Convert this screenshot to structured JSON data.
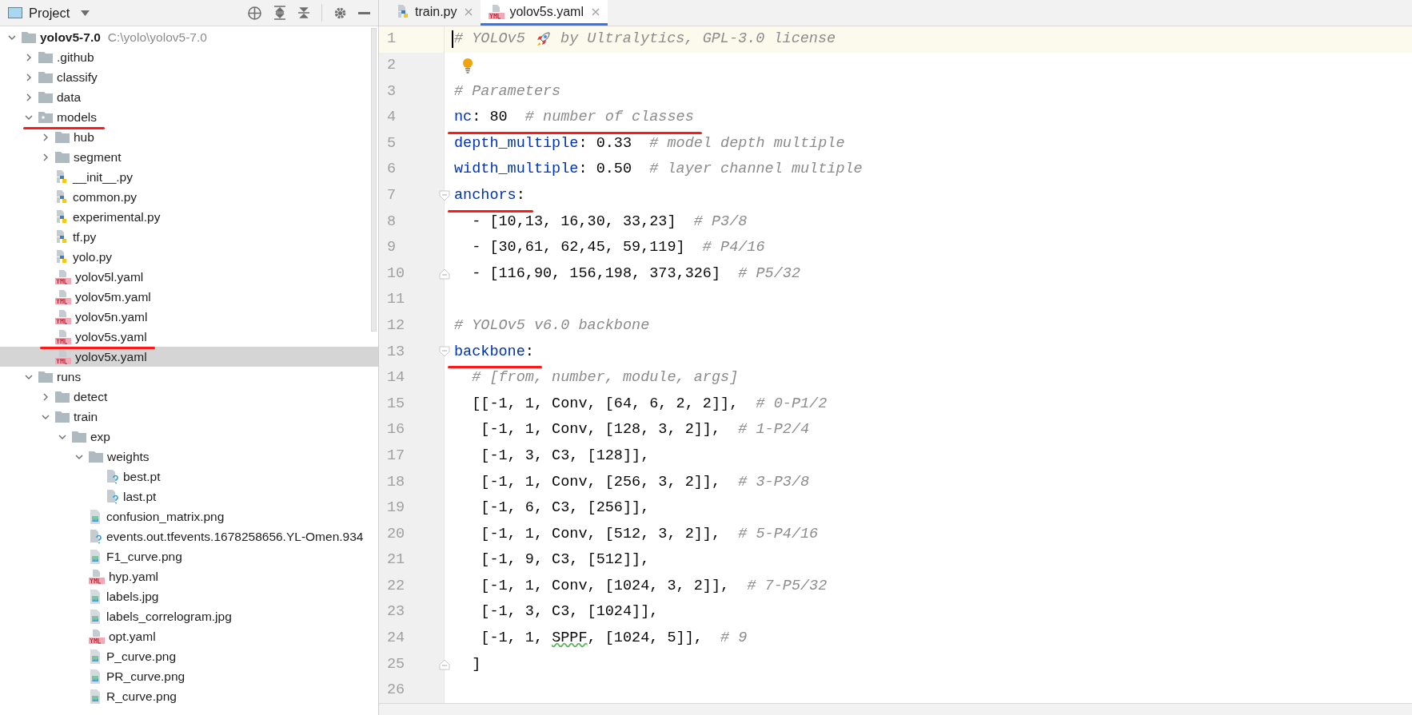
{
  "project_panel": {
    "title": "Project",
    "tree": [
      {
        "name": "yolov5-7.0",
        "path": "C:\\yolo\\yolov5-7.0",
        "kind": "folder",
        "expanded": true,
        "selected": false,
        "marked": false,
        "children": [
          {
            "name": ".github",
            "kind": "folder",
            "expanded": false,
            "selected": false,
            "marked": false
          },
          {
            "name": "classify",
            "kind": "folder",
            "expanded": false,
            "selected": false,
            "marked": false
          },
          {
            "name": "data",
            "kind": "folder",
            "expanded": false,
            "selected": false,
            "marked": false
          },
          {
            "name": "models",
            "kind": "package",
            "expanded": true,
            "selected": false,
            "marked": true,
            "children": [
              {
                "name": "hub",
                "kind": "folder",
                "expanded": false,
                "selected": false,
                "marked": false
              },
              {
                "name": "segment",
                "kind": "folder",
                "expanded": false,
                "selected": false,
                "marked": false
              },
              {
                "name": "__init__.py",
                "kind": "python",
                "selected": false,
                "marked": false
              },
              {
                "name": "common.py",
                "kind": "python",
                "selected": false,
                "marked": false
              },
              {
                "name": "experimental.py",
                "kind": "python",
                "selected": false,
                "marked": false
              },
              {
                "name": "tf.py",
                "kind": "python",
                "selected": false,
                "marked": false
              },
              {
                "name": "yolo.py",
                "kind": "python",
                "selected": false,
                "marked": false
              },
              {
                "name": "yolov5l.yaml",
                "kind": "yaml",
                "selected": false,
                "marked": false
              },
              {
                "name": "yolov5m.yaml",
                "kind": "yaml",
                "selected": false,
                "marked": false
              },
              {
                "name": "yolov5n.yaml",
                "kind": "yaml",
                "selected": false,
                "marked": false
              },
              {
                "name": "yolov5s.yaml",
                "kind": "yaml",
                "selected": false,
                "marked": true
              },
              {
                "name": "yolov5x.yaml",
                "kind": "yaml",
                "selected": true,
                "marked": false
              }
            ]
          },
          {
            "name": "runs",
            "kind": "folder",
            "expanded": true,
            "selected": false,
            "marked": false,
            "children": [
              {
                "name": "detect",
                "kind": "folder",
                "expanded": false,
                "selected": false,
                "marked": false
              },
              {
                "name": "train",
                "kind": "folder",
                "expanded": true,
                "selected": false,
                "marked": false,
                "children": [
                  {
                    "name": "exp",
                    "kind": "folder",
                    "expanded": true,
                    "selected": false,
                    "marked": false,
                    "children": [
                      {
                        "name": "weights",
                        "kind": "folder",
                        "expanded": true,
                        "selected": false,
                        "marked": false,
                        "children": [
                          {
                            "name": "best.pt",
                            "kind": "unknown",
                            "selected": false,
                            "marked": false
                          },
                          {
                            "name": "last.pt",
                            "kind": "unknown",
                            "selected": false,
                            "marked": false
                          }
                        ]
                      },
                      {
                        "name": "confusion_matrix.png",
                        "kind": "image",
                        "selected": false,
                        "marked": false
                      },
                      {
                        "name": "events.out.tfevents.1678258656.YL-Omen.934",
                        "kind": "unknown",
                        "selected": false,
                        "marked": false
                      },
                      {
                        "name": "F1_curve.png",
                        "kind": "image",
                        "selected": false,
                        "marked": false
                      },
                      {
                        "name": "hyp.yaml",
                        "kind": "yaml",
                        "selected": false,
                        "marked": false
                      },
                      {
                        "name": "labels.jpg",
                        "kind": "image",
                        "selected": false,
                        "marked": false
                      },
                      {
                        "name": "labels_correlogram.jpg",
                        "kind": "image",
                        "selected": false,
                        "marked": false
                      },
                      {
                        "name": "opt.yaml",
                        "kind": "yaml",
                        "selected": false,
                        "marked": false
                      },
                      {
                        "name": "P_curve.png",
                        "kind": "image",
                        "selected": false,
                        "marked": false
                      },
                      {
                        "name": "PR_curve.png",
                        "kind": "image",
                        "selected": false,
                        "marked": false
                      },
                      {
                        "name": "R_curve.png",
                        "kind": "image",
                        "selected": false,
                        "marked": false
                      }
                    ]
                  }
                ]
              }
            ]
          }
        ]
      }
    ]
  },
  "tabs": [
    {
      "label": "train.py",
      "kind": "python",
      "selected": false
    },
    {
      "label": "yolov5s.yaml",
      "kind": "yaml",
      "selected": true
    }
  ],
  "editor": {
    "lines": [
      {
        "number": "1",
        "current": true,
        "marked": false,
        "tokens": [
          {
            "kind": "comment",
            "text": "# YOLOv5 "
          },
          {
            "kind": "rocket"
          },
          {
            "kind": "comment",
            "text": " by Ultralytics, GPL-3.0 license"
          }
        ]
      },
      {
        "number": "2",
        "current": false,
        "marked": false,
        "tokens": [
          {
            "kind": "bulb"
          }
        ]
      },
      {
        "number": "3",
        "current": false,
        "marked": false,
        "tokens": [
          {
            "kind": "comment",
            "text": "# Parameters"
          }
        ]
      },
      {
        "number": "4",
        "current": false,
        "marked": true,
        "tokens": [
          {
            "kind": "key",
            "text": "nc"
          },
          {
            "kind": "plain",
            "text": ": 80  "
          },
          {
            "kind": "comment",
            "text": "# number of classes"
          }
        ]
      },
      {
        "number": "5",
        "current": false,
        "marked": false,
        "tokens": [
          {
            "kind": "key",
            "text": "depth_multiple"
          },
          {
            "kind": "plain",
            "text": ": 0.33  "
          },
          {
            "kind": "comment",
            "text": "# model depth multiple"
          }
        ]
      },
      {
        "number": "6",
        "current": false,
        "marked": false,
        "tokens": [
          {
            "kind": "key",
            "text": "width_multiple"
          },
          {
            "kind": "plain",
            "text": ": 0.50  "
          },
          {
            "kind": "comment",
            "text": "# layer channel multiple"
          }
        ]
      },
      {
        "number": "7",
        "current": false,
        "marked": true,
        "fold_start": true,
        "tokens": [
          {
            "kind": "key",
            "text": "anchors"
          },
          {
            "kind": "plain",
            "text": ":"
          }
        ]
      },
      {
        "number": "8",
        "current": false,
        "marked": false,
        "tokens": [
          {
            "kind": "plain",
            "text": "  - [10,13, 16,30, 33,23]  "
          },
          {
            "kind": "comment",
            "text": "# P3/8"
          }
        ]
      },
      {
        "number": "9",
        "current": false,
        "marked": false,
        "tokens": [
          {
            "kind": "plain",
            "text": "  - [30,61, 62,45, 59,119]  "
          },
          {
            "kind": "comment",
            "text": "# P4/16"
          }
        ]
      },
      {
        "number": "10",
        "current": false,
        "marked": false,
        "fold_end": true,
        "tokens": [
          {
            "kind": "plain",
            "text": "  - [116,90, 156,198, 373,326]  "
          },
          {
            "kind": "comment",
            "text": "# P5/32"
          }
        ]
      },
      {
        "number": "11",
        "current": false,
        "marked": false
      },
      {
        "number": "12",
        "current": false,
        "marked": false,
        "tokens": [
          {
            "kind": "comment",
            "text": "# YOLOv5 v6.0 backbone"
          }
        ]
      },
      {
        "number": "13",
        "current": false,
        "marked": true,
        "fold_start": true,
        "tokens": [
          {
            "kind": "key",
            "text": "backbone"
          },
          {
            "kind": "plain",
            "text": ":"
          }
        ]
      },
      {
        "number": "14",
        "current": false,
        "marked": false,
        "tokens": [
          {
            "kind": "comment",
            "text": "  # [from, number, module, args]"
          }
        ]
      },
      {
        "number": "15",
        "current": false,
        "marked": false,
        "tokens": [
          {
            "kind": "plain",
            "text": "  [[-1, 1, Conv, [64, 6, 2, 2]],  "
          },
          {
            "kind": "comment",
            "text": "# 0-P1/2"
          }
        ]
      },
      {
        "number": "16",
        "current": false,
        "marked": false,
        "tokens": [
          {
            "kind": "plain",
            "text": "   [-1, 1, Conv, [128, 3, 2]],  "
          },
          {
            "kind": "comment",
            "text": "# 1-P2/4"
          }
        ]
      },
      {
        "number": "17",
        "current": false,
        "marked": false,
        "tokens": [
          {
            "kind": "plain",
            "text": "   [-1, 3, C3, [128]],"
          }
        ]
      },
      {
        "number": "18",
        "current": false,
        "marked": false,
        "tokens": [
          {
            "kind": "plain",
            "text": "   [-1, 1, Conv, [256, 3, 2]],  "
          },
          {
            "kind": "comment",
            "text": "# 3-P3/8"
          }
        ]
      },
      {
        "number": "19",
        "current": false,
        "marked": false,
        "tokens": [
          {
            "kind": "plain",
            "text": "   [-1, 6, C3, [256]],"
          }
        ]
      },
      {
        "number": "20",
        "current": false,
        "marked": false,
        "tokens": [
          {
            "kind": "plain",
            "text": "   [-1, 1, Conv, [512, 3, 2]],  "
          },
          {
            "kind": "comment",
            "text": "# 5-P4/16"
          }
        ]
      },
      {
        "number": "21",
        "current": false,
        "marked": false,
        "tokens": [
          {
            "kind": "plain",
            "text": "   [-1, 9, C3, [512]],"
          }
        ]
      },
      {
        "number": "22",
        "current": false,
        "marked": false,
        "tokens": [
          {
            "kind": "plain",
            "text": "   [-1, 1, Conv, [1024, 3, 2]],  "
          },
          {
            "kind": "comment",
            "text": "# 7-P5/32"
          }
        ]
      },
      {
        "number": "23",
        "current": false,
        "marked": false,
        "tokens": [
          {
            "kind": "plain",
            "text": "   [-1, 3, C3, [1024]],"
          }
        ]
      },
      {
        "number": "24",
        "current": false,
        "marked": false,
        "tokens": [
          {
            "kind": "plain",
            "text": "   [-1, 1, "
          },
          {
            "kind": "typo",
            "text": "SPPF"
          },
          {
            "kind": "plain",
            "text": ", [1024, 5]],  "
          },
          {
            "kind": "comment",
            "text": "# 9"
          }
        ]
      },
      {
        "number": "25",
        "current": false,
        "marked": false,
        "fold_end": true,
        "tokens": [
          {
            "kind": "plain",
            "text": "  ]"
          }
        ]
      },
      {
        "number": "26",
        "current": false,
        "marked": false
      }
    ]
  }
}
